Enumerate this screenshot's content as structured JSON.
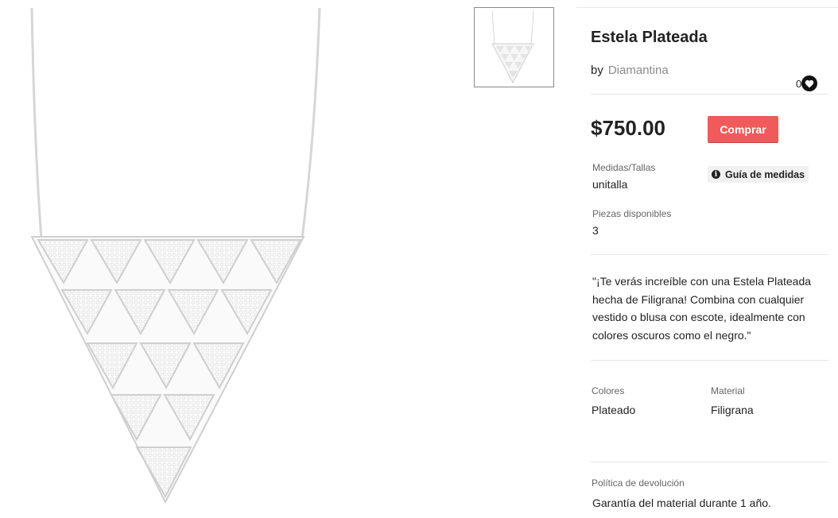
{
  "product": {
    "title": "Estela Plateada",
    "by_label": "by",
    "designer": "Diamantina",
    "likes": "0",
    "price": "$750.00",
    "buy_label": "Comprar"
  },
  "specs": {
    "size_label": "Medidas/Tallas",
    "size_value": "unitalla",
    "size_guide_label": "Guía de medidas",
    "pieces_label": "Piezas disponibles",
    "pieces_value": "3"
  },
  "description": "\"¡Te verás increíble con una Estela Plateada hecha de Filigrana! Combina con cualquier vestido o blusa con escote, idealmente con colores oscuros como el negro.\"",
  "attributes": {
    "colors_label": "Colores",
    "colors_value": "Plateado",
    "material_label": "Material",
    "material_value": "Filigrana"
  },
  "policy": {
    "label": "Política de devolución",
    "value": "Garantía del material durante 1 año."
  },
  "colors": {
    "buy_button": "#f05a5a",
    "heart_button": "#111111",
    "link": "#8a8a8a"
  },
  "icons": {
    "heart": "heart-icon",
    "info": "info-icon"
  }
}
